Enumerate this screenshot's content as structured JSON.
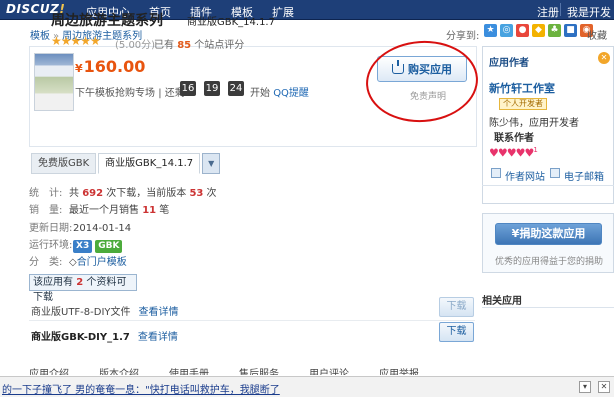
{
  "topnav": {
    "logo": "DISCUZ",
    "logo_bang": "!",
    "logo_sub": "应用中心",
    "items": [
      "首页",
      "插件",
      "模板",
      "扩展"
    ],
    "register": "注册",
    "developer": "我是开发者"
  },
  "breadcrumb": {
    "root": "模板",
    "sep": "»",
    "current": "周边旅游主题系列"
  },
  "share": {
    "label": "分享到:",
    "more": "收藏"
  },
  "product": {
    "title": "周边旅游主题系列",
    "edition": "商业版GBK_14.1.7",
    "stars": "★★★★★",
    "score": "(5.00分)",
    "reviews_pre": "已有",
    "reviews_count": "85",
    "reviews_post": "个站点评分",
    "currency": "¥",
    "price": "160.00",
    "sale_label": "下午模板抢购专场",
    "sale_sep": "| 还剩",
    "timer": [
      "16",
      "19",
      "24"
    ],
    "sale_start": "开始",
    "qq_remind": "QQ提醒",
    "buy_label": "购买应用",
    "disclaimer": "免责声明"
  },
  "tabs": {
    "free": "免费版GBK",
    "commercial": "商业版GBK_14.1.7",
    "drop": "▼"
  },
  "info": {
    "stats_key": "统　计:",
    "stats_pre": "共",
    "stats_count": "692",
    "stats_mid": "次下载，当前版本",
    "stats_ver": "53",
    "stats_post": "次",
    "sales_key": "销　量:",
    "sales_pre": "最近一个月销售",
    "sales_count": "11",
    "sales_post": "笔",
    "updated_key": "更新日期:",
    "updated": "2014-01-14",
    "env_key": "运行环境:",
    "env_x3": "X3",
    "env_gbk": "GBK",
    "cat_key": "分　类:",
    "category": "合门户模板"
  },
  "downloads": {
    "head_pre": "该应用有",
    "head_count": "2",
    "head_post": "个资料可下载",
    "items": [
      {
        "name": "商业版UTF-8-DIY文件",
        "link": "查看详情",
        "button": "下载"
      },
      {
        "name": "商业版GBK-DIY_1.7",
        "link": "查看详情",
        "button": "下载"
      }
    ]
  },
  "bottom_tabs": [
    "应用介绍",
    "版本介绍",
    "使用手册",
    "售后服务",
    "用户评论",
    "应用举报"
  ],
  "sidebar": {
    "title": "应用作者",
    "studio": "新竹轩工作室",
    "dev_badge": "个人开发者",
    "dev_name": "陈少伟，应用开发者",
    "contact": "联系作者",
    "hearts": "♥♥♥♥♥",
    "hearts_count": "1",
    "site_link": "作者网站",
    "mail_link": "电子邮箱",
    "donate": "¥捐助这款应用",
    "donate_note": "优秀的应用得益于您的捐助",
    "related": "相关应用"
  },
  "marquee": {
    "text": "的一下子撞飞了 男的奄奄一息：\"快打电话叫救护车，我腿断了"
  },
  "colors": {
    "nav": "#1e3f78",
    "price": "#e8540f",
    "annotation": "#d81010"
  }
}
